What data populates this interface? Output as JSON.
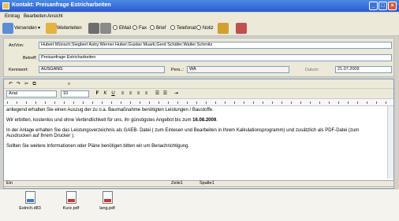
{
  "window": {
    "title": "Kontakt: Preisanfrage Estricharbeiten"
  },
  "menu": [
    "Eintrag",
    "Bearbeiten",
    "Ansicht"
  ],
  "toolbar": {
    "send_label": "Versenden",
    "forward_label": "Weiterleiten",
    "channels": [
      "EMail",
      "Fax",
      "Brief",
      "Telefonat",
      "Notiz"
    ]
  },
  "form": {
    "an_von_label": "An/Von:",
    "an_von_value": "Hubert Münsch;Siegbert Astry;Werner Huber;Gustav Muark;Gerd Schäfer;Walter Schmitz",
    "betreff_label": "Betreff:",
    "betreff_value": "Preisanfrage Estricharbeiten",
    "kennwort_label": "Kennwort:",
    "kennwort_value": "AUSGANG",
    "pers_label": "Pers..:",
    "pers_value": "WA",
    "datum_label": "Datum:",
    "datum_value": "21.07.2009"
  },
  "editor": {
    "font": "Arial",
    "size": "10",
    "paragraphs": [
      "anliegend erhalten Sie einen Auszug der zu o.a. Baumaßnahme benötigten Leistungen / Baustoffe.",
      "Wir erbitten, kostenlos und ohne Verbindlichkeit für uns, ihr günstigstes Angebot bis zum ",
      "In der Anlage erhalten Sie das Leistungsverzeichnis als GAEB- Datei ( zum Einlesen und Bearbeiten in Ihrem Kalkulationsprogramm) und zusätzlich als PDF-Datei  (zum Ausdrucken auf Ihrem Drucker ).",
      "Sollten Sie weitere Informationen oder Pläne benötigen bitten wir um Benachrichtigung."
    ],
    "deadline": "16.08.2009"
  },
  "status": {
    "mode": "Ein",
    "row": "Zeile1",
    "col": "Spalte1"
  },
  "attachments": [
    "Estrich.d83",
    "Kurz.pdf",
    "lang.pdf"
  ]
}
